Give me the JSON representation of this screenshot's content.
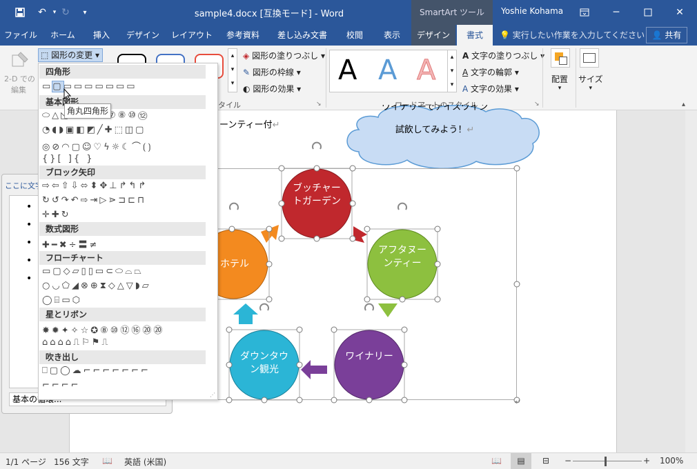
{
  "titlebar": {
    "title": "sample4.docx [互換モード] - Word",
    "context_tool": "SmartArt ツール",
    "user": "Yoshie Kohama"
  },
  "tabs": [
    "ファイル",
    "ホーム",
    "挿入",
    "デザイン",
    "レイアウト",
    "参考資料",
    "差し込み文書",
    "校閲",
    "表示",
    "デザイン",
    "書式"
  ],
  "tellme": "実行したい作業を入力してください",
  "share": "共有",
  "ribbon": {
    "twod_edit_line1": "2-D での",
    "twod_edit_line2": "編集",
    "change_shape": "図形の変更",
    "shape_fill": "図形の塗りつぶし",
    "shape_outline": "図形の枠線",
    "shape_effects": "図形の効果",
    "style_group_tail": "タイル",
    "text_fill": "文字の塗りつぶし",
    "text_outline": "文字の輪郭",
    "text_effects": "文字の効果",
    "wordart_letter": "A",
    "wordart_group": "ワードアートのスタイル",
    "arrange": "配置",
    "size": "サイズ"
  },
  "textpane": {
    "header": "ここに文字",
    "footer": "基本の循環..."
  },
  "dropdown": {
    "sections": [
      "四角形",
      "基本図形",
      "ブロック矢印",
      "数式図形",
      "フローチャート",
      "星とリボン",
      "吹き出し"
    ],
    "tooltip": "角丸四角形"
  },
  "document": {
    "text_line": "ーンティー付",
    "cloud_line1": "ワイナリーでアイスワイン",
    "cloud_line2": "試飲してみよう！",
    "nodes": [
      {
        "label": "ブッチャートガーデン",
        "color": "#c0282d"
      },
      {
        "label": "アフタヌーンティー",
        "color": "#8dc03f"
      },
      {
        "label": "ワイナリー",
        "color": "#7a3f99"
      },
      {
        "label": "ダウンタウン観光",
        "color": "#2bb5d6"
      },
      {
        "label": "ホテル",
        "color": "#f38a1f"
      }
    ]
  },
  "status": {
    "page": "1/1 ページ",
    "words": "156 文字",
    "lang": "英語 (米国)",
    "zoom": "100%"
  }
}
